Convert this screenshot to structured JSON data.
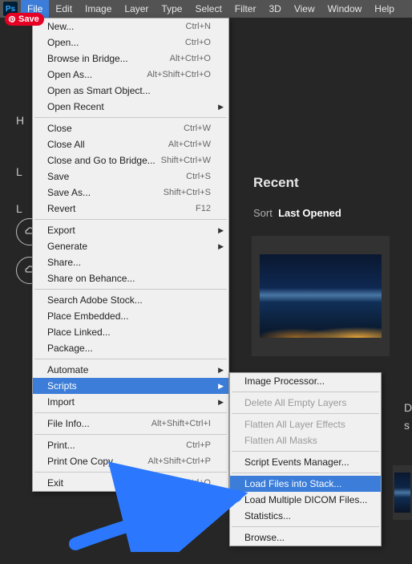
{
  "menubar": {
    "logo": "Ps",
    "items": [
      "File",
      "Edit",
      "Image",
      "Layer",
      "Type",
      "Select",
      "Filter",
      "3D",
      "View",
      "Window",
      "Help"
    ],
    "active_index": 0
  },
  "save_btn": "Save",
  "left_fragments": [
    "H",
    "L",
    "L"
  ],
  "right_fragments": [
    "D",
    "s"
  ],
  "recent": {
    "title": "Recent",
    "sort_label": "Sort",
    "sort_value": "Last Opened"
  },
  "file_menu": [
    {
      "label": "New...",
      "accel": "Ctrl+N"
    },
    {
      "label": "Open...",
      "accel": "Ctrl+O"
    },
    {
      "label": "Browse in Bridge...",
      "accel": "Alt+Ctrl+O"
    },
    {
      "label": "Open As...",
      "accel": "Alt+Shift+Ctrl+O"
    },
    {
      "label": "Open as Smart Object..."
    },
    {
      "label": "Open Recent",
      "submenu": true
    },
    {
      "sep": true
    },
    {
      "label": "Close",
      "accel": "Ctrl+W"
    },
    {
      "label": "Close All",
      "accel": "Alt+Ctrl+W"
    },
    {
      "label": "Close and Go to Bridge...",
      "accel": "Shift+Ctrl+W"
    },
    {
      "label": "Save",
      "accel": "Ctrl+S"
    },
    {
      "label": "Save As...",
      "accel": "Shift+Ctrl+S"
    },
    {
      "label": "Revert",
      "accel": "F12"
    },
    {
      "sep": true
    },
    {
      "label": "Export",
      "submenu": true
    },
    {
      "label": "Generate",
      "submenu": true
    },
    {
      "label": "Share..."
    },
    {
      "label": "Share on Behance..."
    },
    {
      "sep": true
    },
    {
      "label": "Search Adobe Stock..."
    },
    {
      "label": "Place Embedded..."
    },
    {
      "label": "Place Linked..."
    },
    {
      "label": "Package..."
    },
    {
      "sep": true
    },
    {
      "label": "Automate",
      "submenu": true
    },
    {
      "label": "Scripts",
      "submenu": true,
      "highlight": true
    },
    {
      "label": "Import",
      "submenu": true
    },
    {
      "sep": true
    },
    {
      "label": "File Info...",
      "accel": "Alt+Shift+Ctrl+I"
    },
    {
      "sep": true
    },
    {
      "label": "Print...",
      "accel": "Ctrl+P"
    },
    {
      "label": "Print One Copy",
      "accel": "Alt+Shift+Ctrl+P"
    },
    {
      "sep": true
    },
    {
      "label": "Exit",
      "accel": "Ctrl+Q"
    }
  ],
  "scripts_menu": [
    {
      "label": "Image Processor..."
    },
    {
      "sep": true
    },
    {
      "label": "Delete All Empty Layers",
      "disabled": true
    },
    {
      "sep": true
    },
    {
      "label": "Flatten All Layer Effects",
      "disabled": true
    },
    {
      "label": "Flatten All Masks",
      "disabled": true
    },
    {
      "sep": true
    },
    {
      "label": "Script Events Manager..."
    },
    {
      "sep": true
    },
    {
      "label": "Load Files into Stack...",
      "highlight": true
    },
    {
      "label": "Load Multiple DICOM Files..."
    },
    {
      "label": "Statistics..."
    },
    {
      "sep": true
    },
    {
      "label": "Browse..."
    }
  ]
}
